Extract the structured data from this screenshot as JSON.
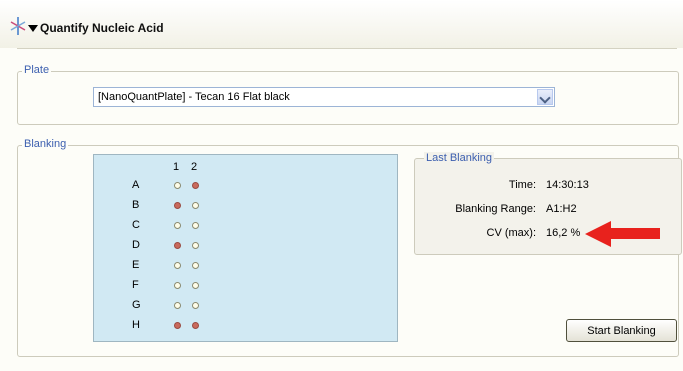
{
  "header": {
    "title": "Quantify Nucleic Acid",
    "app_icon": "tool-icon",
    "collapse_icon": "triangle-down-icon"
  },
  "plate_group": {
    "label": "Plate",
    "selected": "[NanoQuantPlate] - Tecan 16 Flat black",
    "dropdown_icon": "chevron-down-icon"
  },
  "blanking_group": {
    "label": "Blanking",
    "columns": [
      "1",
      "2"
    ],
    "rows": [
      {
        "label": "A",
        "wells": [
          "empty",
          "red"
        ]
      },
      {
        "label": "B",
        "wells": [
          "red",
          "empty"
        ]
      },
      {
        "label": "C",
        "wells": [
          "empty",
          "empty"
        ]
      },
      {
        "label": "D",
        "wells": [
          "red",
          "empty"
        ]
      },
      {
        "label": "E",
        "wells": [
          "empty",
          "empty"
        ]
      },
      {
        "label": "F",
        "wells": [
          "empty",
          "empty"
        ]
      },
      {
        "label": "G",
        "wells": [
          "empty",
          "empty"
        ]
      },
      {
        "label": "H",
        "wells": [
          "red",
          "red"
        ]
      }
    ],
    "last_blanking": {
      "label": "Last Blanking",
      "time_label": "Time:",
      "time": "14:30:13",
      "range_label": "Blanking Range:",
      "range": "A1:H2",
      "cv_label": "CV (max):",
      "cv": "16,2 %"
    },
    "start_button": "Start Blanking"
  },
  "colors": {
    "accent": "#3c5faf",
    "well_red": "#c96a5c",
    "plate_bg": "#d1e9f3",
    "arrow": "#e8221d"
  }
}
